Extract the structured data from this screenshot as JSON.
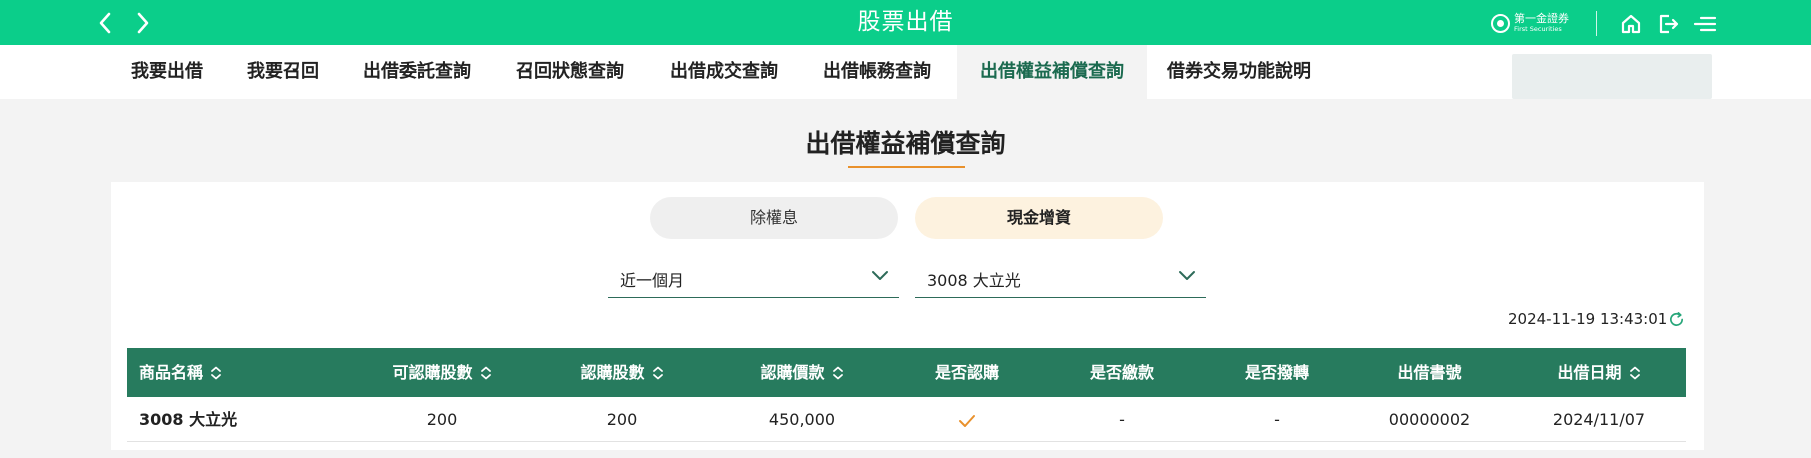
{
  "app": {
    "title": "股票出借",
    "brand_cn": "第一金證券",
    "brand_en": "First Securities"
  },
  "tabs": [
    {
      "label": "我要出借"
    },
    {
      "label": "我要召回"
    },
    {
      "label": "出借委託查詢"
    },
    {
      "label": "召回狀態查詢"
    },
    {
      "label": "出借成交查詢"
    },
    {
      "label": "出借帳務查詢"
    },
    {
      "label": "出借權益補償查詢",
      "active": true
    },
    {
      "label": "借券交易功能說明"
    }
  ],
  "page": {
    "heading": "出借權益補償查詢"
  },
  "segments": [
    {
      "label": "除權息",
      "selected": false
    },
    {
      "label": "現金增資",
      "selected": true
    }
  ],
  "filters": {
    "period": "近一個月",
    "stock": "3008 大立光"
  },
  "timestamp": "2024-11-19 13:43:01",
  "table": {
    "columns": [
      {
        "label": "商品名稱",
        "sortable": true
      },
      {
        "label": "可認購股數",
        "sortable": true
      },
      {
        "label": "認購股數",
        "sortable": true
      },
      {
        "label": "認購價款",
        "sortable": true
      },
      {
        "label": "是否認購",
        "sortable": false
      },
      {
        "label": "是否繳款",
        "sortable": false
      },
      {
        "label": "是否撥轉",
        "sortable": false
      },
      {
        "label": "出借書號",
        "sortable": false
      },
      {
        "label": "出借日期",
        "sortable": true
      }
    ],
    "rows": [
      {
        "name": "3008 大立光",
        "subscribable_shares": "200",
        "subscribed_shares": "200",
        "subscription_amount": "450,000",
        "subscribed": true,
        "paid": "-",
        "transferred": "-",
        "lending_no": "00000002",
        "lending_date": "2024/11/07"
      }
    ]
  },
  "colors": {
    "topbar": "#0bce8a",
    "table_header": "#277b5e",
    "accent_orange": "#e9912c",
    "active_tab_text": "#1b6a4f"
  },
  "icons": [
    "back-arrow-icon",
    "forward-arrow-icon",
    "home-icon",
    "logout-icon",
    "menu-icon",
    "chevron-down-icon",
    "refresh-icon",
    "sort-icon",
    "checkmark-icon"
  ]
}
